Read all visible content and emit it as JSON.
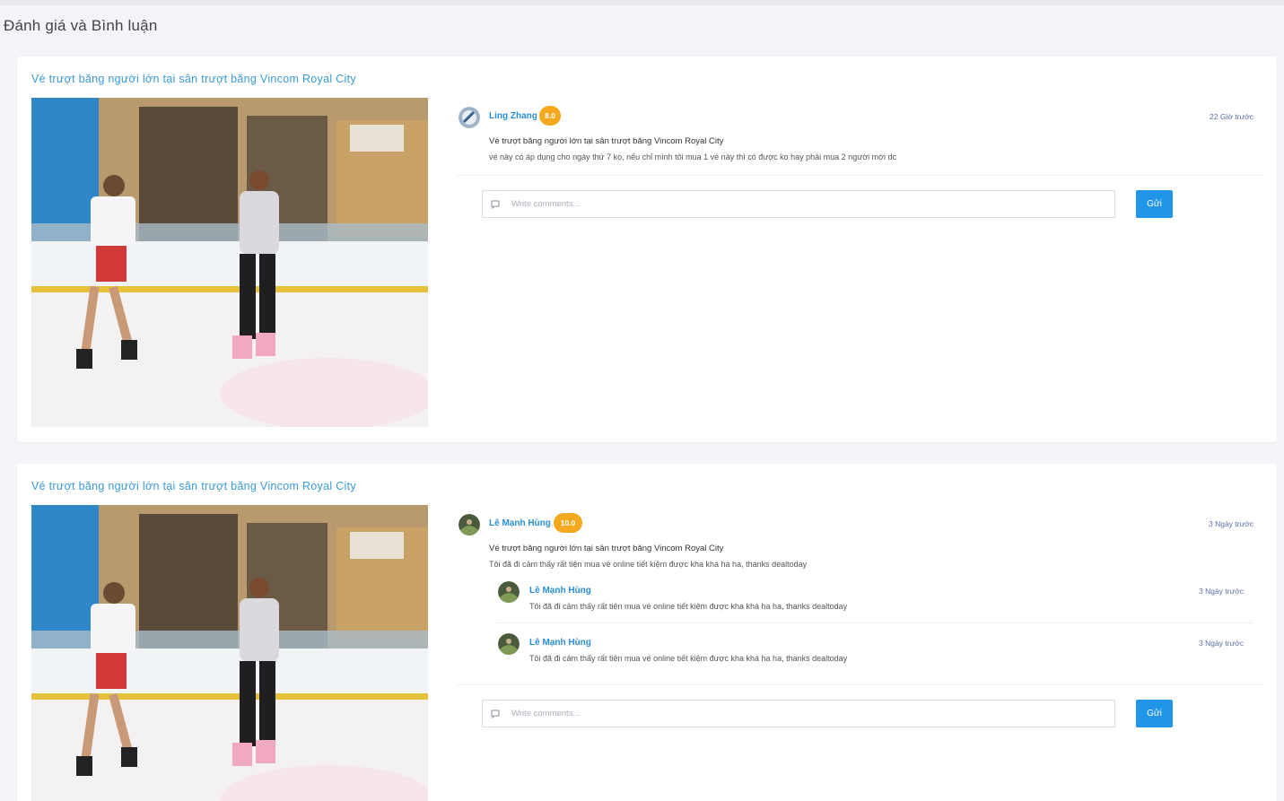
{
  "page": {
    "title": "Đánh giá và Bình luận"
  },
  "cards": [
    {
      "product_title": "Vé trượt băng người lớn tại sân trượt băng Vincom Royal City",
      "review": {
        "user": "Ling Zhang",
        "score": "8.0",
        "time": "22 Giờ trước",
        "title": "Vé trượt băng người lớn tại sân trượt băng Vincom Royal City",
        "text": "vé này có áp dụng cho ngày thứ 7 ko, nếu chỉ mình tôi mua 1 vé này thì có được ko hay phải mua 2 người mới dc"
      },
      "replies": [],
      "comment_placeholder": "Write comments...",
      "send_label": "Gửi"
    },
    {
      "product_title": "Vé trượt băng người lớn tại sân trượt băng Vincom Royal City",
      "review": {
        "user": "Lê Mạnh Hùng",
        "score": "10.0",
        "time": "3 Ngày trước",
        "title": "Vé trượt băng người lớn tại sân trượt băng Vincom Royal City",
        "text": "Tôi đã đi cảm thấy rất tiện mua vé online tiết kiệm được kha khá ha ha, thanks dealtoday"
      },
      "replies": [
        {
          "user": "Lê Mạnh Hùng",
          "time": "3 Ngày trước",
          "text": "Tôi đã đi cảm thấy rất tiện mua vé online tiết kiệm được kha khá ha ha, thanks dealtoday"
        },
        {
          "user": "Lê Mạnh Hùng",
          "time": "3 Ngày trước",
          "text": "Tôi đã đi cảm thấy rất tiện mua vé online tiết kiệm được kha khá ha ha, thanks dealtoday"
        }
      ],
      "comment_placeholder": "Write comments...",
      "send_label": "Gửi"
    }
  ],
  "icons": {
    "comment": "comment-icon",
    "avatar": "avatar-image",
    "photo": "ice-rink-photo"
  },
  "colors": {
    "accent": "#2196e8",
    "link": "#2a8fd6",
    "score_badge": "#f4a81d",
    "time": "#5c6fa8"
  }
}
